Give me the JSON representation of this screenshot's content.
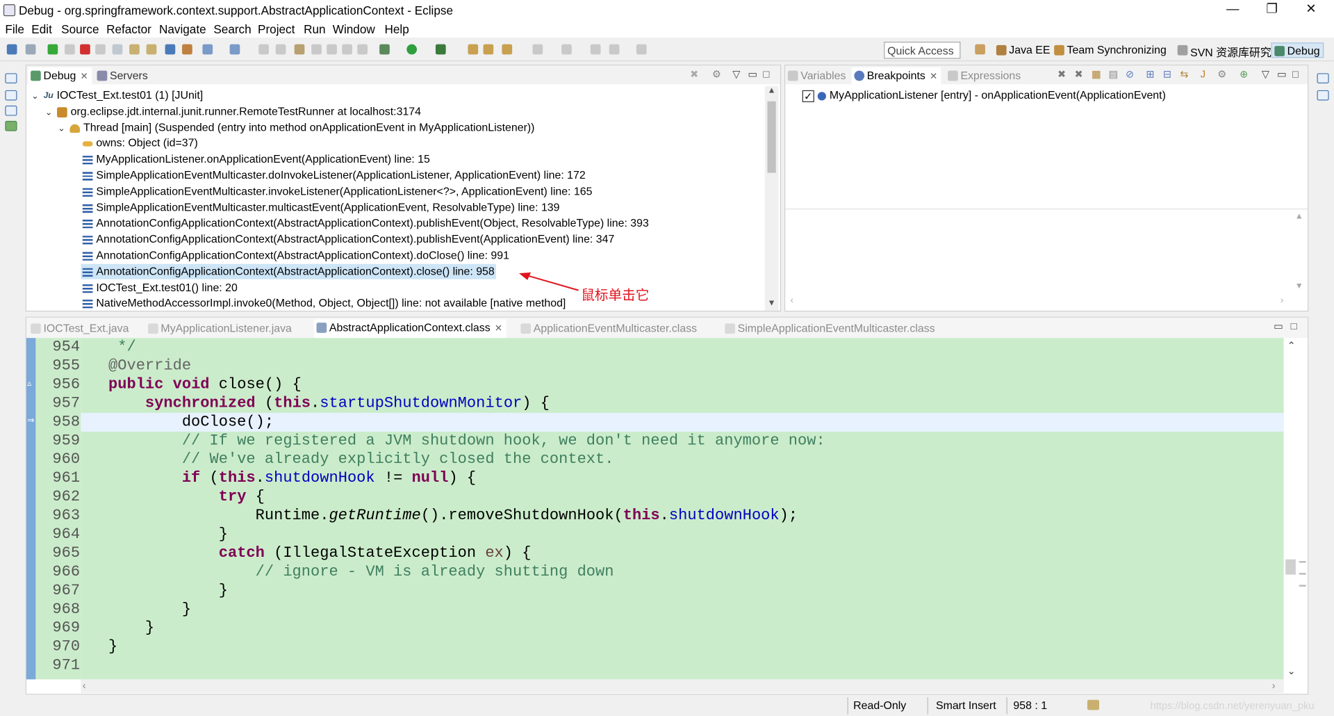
{
  "window": {
    "title": "Debug - org.springframework.context.support.AbstractApplicationContext - Eclipse",
    "minimize": "—",
    "restore": "❐",
    "close": "✕"
  },
  "menu": [
    "File",
    "Edit",
    "Source",
    "Refactor",
    "Navigate",
    "Search",
    "Project",
    "Run",
    "Window",
    "Help"
  ],
  "toolbar": {
    "quick_access_placeholder": "Quick Access",
    "perspectives": [
      {
        "label": "Java EE",
        "icon": "java-ee-icon"
      },
      {
        "label": "Team Synchronizing",
        "icon": "team-sync-icon"
      },
      {
        "label": "SVN 资源库研究",
        "icon": "svn-icon"
      },
      {
        "label": "Debug",
        "icon": "debug-bug-icon",
        "active": true
      }
    ]
  },
  "debug_view": {
    "tabs": [
      {
        "label": "Debug",
        "active": true,
        "closable": true
      },
      {
        "label": "Servers",
        "active": false
      }
    ],
    "tree": [
      {
        "text": "IOCTest_Ext.test01 (1) [JUnit]",
        "icon": "junit-launch-icon",
        "expanded": true
      },
      {
        "text": "org.eclipse.jdt.internal.junit.runner.RemoteTestRunner at localhost:3174",
        "icon": "process-icon",
        "expanded": true
      },
      {
        "text": "Thread [main] (Suspended (entry into method onApplicationEvent in MyApplicationListener))",
        "icon": "thread-suspended-icon",
        "expanded": true
      },
      {
        "text": "owns: Object  (id=37)",
        "icon": "monitor-key-icon"
      },
      {
        "text": "MyApplicationListener.onApplicationEvent(ApplicationEvent) line: 15",
        "icon": "stack-frame-icon"
      },
      {
        "text": "SimpleApplicationEventMulticaster.doInvokeListener(ApplicationListener, ApplicationEvent) line: 172",
        "icon": "stack-frame-icon"
      },
      {
        "text": "SimpleApplicationEventMulticaster.invokeListener(ApplicationListener<?>, ApplicationEvent) line: 165",
        "icon": "stack-frame-icon"
      },
      {
        "text": "SimpleApplicationEventMulticaster.multicastEvent(ApplicationEvent, ResolvableType) line: 139",
        "icon": "stack-frame-icon"
      },
      {
        "text": "AnnotationConfigApplicationContext(AbstractApplicationContext).publishEvent(Object, ResolvableType) line: 393",
        "icon": "stack-frame-icon"
      },
      {
        "text": "AnnotationConfigApplicationContext(AbstractApplicationContext).publishEvent(ApplicationEvent) line: 347",
        "icon": "stack-frame-icon"
      },
      {
        "text": "AnnotationConfigApplicationContext(AbstractApplicationContext).doClose() line: 991",
        "icon": "stack-frame-icon"
      },
      {
        "text": "AnnotationConfigApplicationContext(AbstractApplicationContext).close() line: 958",
        "icon": "stack-frame-icon",
        "selected": true
      },
      {
        "text": "IOCTest_Ext.test01() line: 20",
        "icon": "stack-frame-icon"
      },
      {
        "text": "NativeMethodAccessorImpl.invoke0(Method, Object, Object[]) line: not available [native method]",
        "icon": "stack-frame-icon"
      }
    ],
    "annotation": "鼠标单击它"
  },
  "breakpoints_view": {
    "tabs": [
      {
        "label": "Variables",
        "active": false
      },
      {
        "label": "Breakpoints",
        "active": true,
        "closable": true
      },
      {
        "label": "Expressions",
        "active": false
      }
    ],
    "items": [
      {
        "label": "MyApplicationListener [entry] - onApplicationEvent(ApplicationEvent)",
        "checked": true
      }
    ]
  },
  "editor": {
    "tabs": [
      {
        "label": "IOCTest_Ext.java",
        "active": false
      },
      {
        "label": "MyApplicationListener.java",
        "active": false
      },
      {
        "label": "AbstractApplicationContext.class",
        "active": true,
        "closable": true
      },
      {
        "label": "ApplicationEventMulticaster.class",
        "active": false
      },
      {
        "label": "SimpleApplicationEventMulticaster.class",
        "active": false
      }
    ],
    "current_line": 958,
    "lines": [
      {
        "no": "954",
        "code": "\t */"
      },
      {
        "no": "955",
        "code": "\t@Override"
      },
      {
        "no": "956",
        "code": "\tpublic void close() {"
      },
      {
        "no": "957",
        "code": "\t\tsynchronized (this.startupShutdownMonitor) {"
      },
      {
        "no": "958",
        "code": "\t\t\tdoClose();"
      },
      {
        "no": "959",
        "code": "\t\t\t// If we registered a JVM shutdown hook, we don't need it anymore now:"
      },
      {
        "no": "960",
        "code": "\t\t\t// We've already explicitly closed the context."
      },
      {
        "no": "961",
        "code": "\t\t\tif (this.shutdownHook != null) {"
      },
      {
        "no": "962",
        "code": "\t\t\t\ttry {"
      },
      {
        "no": "963",
        "code": "\t\t\t\t\tRuntime.getRuntime().removeShutdownHook(this.shutdownHook);"
      },
      {
        "no": "964",
        "code": "\t\t\t\t}"
      },
      {
        "no": "965",
        "code": "\t\t\t\tcatch (IllegalStateException ex) {"
      },
      {
        "no": "966",
        "code": "\t\t\t\t\t// ignore - VM is already shutting down"
      },
      {
        "no": "967",
        "code": "\t\t\t\t}"
      },
      {
        "no": "968",
        "code": "\t\t\t}"
      },
      {
        "no": "969",
        "code": "\t\t}"
      },
      {
        "no": "970",
        "code": "\t}"
      },
      {
        "no": "971",
        "code": ""
      }
    ]
  },
  "status": {
    "read_only": "Read-Only",
    "insert_mode": "Smart Insert",
    "position": "958 : 1",
    "watermark": "https://blog.csdn.net/yerenyuan_pku"
  },
  "colors": {
    "editor_bg": "#cbeccb",
    "current_line": "#e8f2fe",
    "keyword": "#7f0055",
    "field": "#0000c0",
    "comment": "#3f7f5f",
    "annotation_red": "#e0141e",
    "selection": "#cde5f7"
  }
}
